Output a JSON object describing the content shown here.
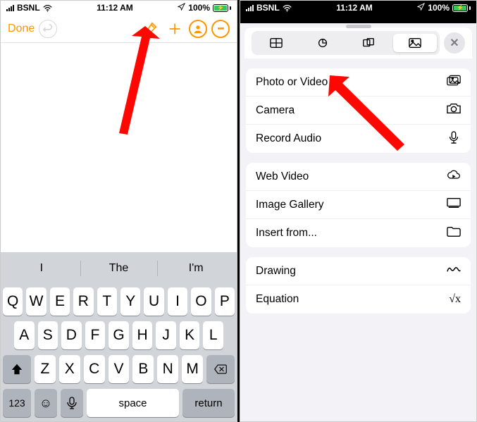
{
  "status": {
    "carrier": "BSNL",
    "time": "11:12 AM",
    "battery_pct": "100%"
  },
  "left": {
    "done": "Done",
    "suggestions": [
      "I",
      "The",
      "I'm"
    ],
    "rows": {
      "r1": [
        "Q",
        "W",
        "E",
        "R",
        "T",
        "Y",
        "U",
        "I",
        "O",
        "P"
      ],
      "r2": [
        "A",
        "S",
        "D",
        "F",
        "G",
        "H",
        "J",
        "K",
        "L"
      ],
      "r3": [
        "Z",
        "X",
        "C",
        "V",
        "B",
        "N",
        "M"
      ]
    },
    "k123": "123",
    "space": "space",
    "return": "return"
  },
  "right": {
    "groups": [
      {
        "items": [
          {
            "label": "Photo or Video",
            "icon": "photo-video"
          },
          {
            "label": "Camera",
            "icon": "camera"
          },
          {
            "label": "Record Audio",
            "icon": "mic"
          }
        ]
      },
      {
        "items": [
          {
            "label": "Web Video",
            "icon": "cloud"
          },
          {
            "label": "Image Gallery",
            "icon": "gallery"
          },
          {
            "label": "Insert from...",
            "icon": "folder"
          }
        ]
      },
      {
        "items": [
          {
            "label": "Drawing",
            "icon": "scribble"
          },
          {
            "label": "Equation",
            "icon": "sqrt"
          }
        ]
      }
    ]
  }
}
